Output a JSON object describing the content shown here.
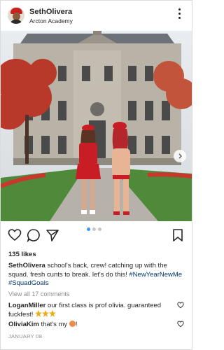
{
  "header": {
    "username": "SethOlivera",
    "location": "Arcton Academy",
    "avatar_icon": "profile-avatar",
    "more_icon": "more-vertical-icon"
  },
  "post": {
    "image_description_icon": "photo",
    "next_icon": "chevron-right-icon",
    "carousel": {
      "count": 3,
      "active": 1
    }
  },
  "actions": {
    "like_icon": "heart-icon",
    "comment_icon": "comment-icon",
    "share_icon": "send-icon",
    "save_icon": "bookmark-icon"
  },
  "likes": "135 likes",
  "caption": {
    "username": "SethOlivera",
    "text": "school's back, crew! catching up with the squad. fresh cunts to break. let's do this!",
    "hashtags": [
      "#NewYearNewMe",
      "#SquadGoals"
    ]
  },
  "view_comments": "View all 17 comments",
  "comments": [
    {
      "username": "LoganMiller",
      "text": "our first class is prof olivia. guaranteed fuckfest!",
      "emojis": 3
    },
    {
      "username": "OliviaKim",
      "text": "that's my",
      "suffix": "!"
    }
  ],
  "date": "JANUARY 08",
  "colors": {
    "link": "#00376b",
    "muted": "#8e8e8e",
    "carousel_active": "#3897f0"
  }
}
